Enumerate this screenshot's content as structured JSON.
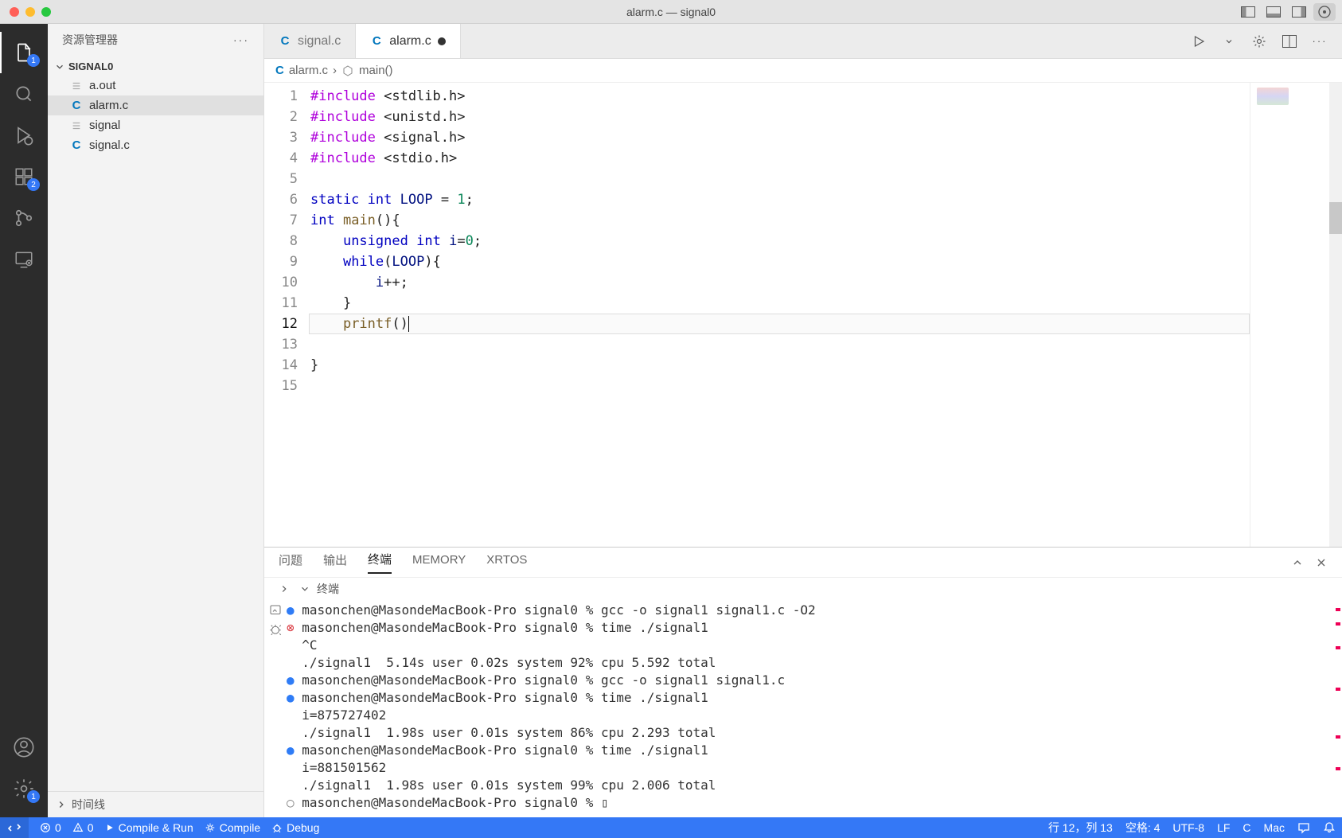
{
  "window": {
    "title": "alarm.c — signal0"
  },
  "activitybar": {
    "explorer_badge": "1",
    "extensions_badge": "2",
    "settings_badge": "1"
  },
  "sidebar": {
    "title": "资源管理器",
    "folder": "SIGNAL0",
    "files": [
      {
        "name": "a.out",
        "icon": "generic"
      },
      {
        "name": "alarm.c",
        "icon": "c",
        "active": true
      },
      {
        "name": "signal",
        "icon": "generic"
      },
      {
        "name": "signal.c",
        "icon": "c"
      }
    ],
    "timeline": "时间线"
  },
  "tabs": {
    "items": [
      {
        "label": "signal.c",
        "icon": "c"
      },
      {
        "label": "alarm.c",
        "icon": "c",
        "active": true,
        "dirty": true
      }
    ]
  },
  "breadcrumb": {
    "file": "alarm.c",
    "symbol": "main()"
  },
  "code": {
    "lines": [
      "#include <stdlib.h>",
      "#include <unistd.h>",
      "#include <signal.h>",
      "#include <stdio.h>",
      "",
      "static int LOOP = 1;",
      "int main(){",
      "    unsigned int i=0;",
      "    while(LOOP){",
      "        i++;",
      "    }",
      "    printf()",
      "",
      "}",
      ""
    ],
    "current_line": 12
  },
  "panel": {
    "tabs": {
      "problems": "问题",
      "output": "输出",
      "terminal": "终端",
      "memory": "MEMORY",
      "xrtos": "XRTOS"
    },
    "terminal_label": "终端",
    "terminal_lines": [
      {
        "b": "blue",
        "t": "masonchen@MasondeMacBook-Pro signal0 % gcc -o signal1 signal1.c -O2"
      },
      {
        "b": "err",
        "t": "masonchen@MasondeMacBook-Pro signal0 % time ./signal1"
      },
      {
        "b": "",
        "t": "^C"
      },
      {
        "b": "",
        "t": "./signal1  5.14s user 0.02s system 92% cpu 5.592 total"
      },
      {
        "b": "blue",
        "t": "masonchen@MasondeMacBook-Pro signal0 % gcc -o signal1 signal1.c"
      },
      {
        "b": "blue",
        "t": "masonchen@MasondeMacBook-Pro signal0 % time ./signal1"
      },
      {
        "b": "",
        "t": "i=875727402"
      },
      {
        "b": "",
        "t": "./signal1  1.98s user 0.01s system 86% cpu 2.293 total"
      },
      {
        "b": "blue",
        "t": "masonchen@MasondeMacBook-Pro signal0 % time ./signal1"
      },
      {
        "b": "",
        "t": "i=881501562"
      },
      {
        "b": "",
        "t": "./signal1  1.98s user 0.01s system 99% cpu 2.006 total"
      },
      {
        "b": "open",
        "t": "masonchen@MasondeMacBook-Pro signal0 % ▯"
      }
    ]
  },
  "statusbar": {
    "errors": "0",
    "warnings": "0",
    "compile_run": "Compile & Run",
    "compile": "Compile",
    "debug": "Debug",
    "ln_col": "行 12，列 13",
    "spaces": "空格: 4",
    "encoding": "UTF-8",
    "eol": "LF",
    "lang": "C",
    "os": "Mac"
  }
}
